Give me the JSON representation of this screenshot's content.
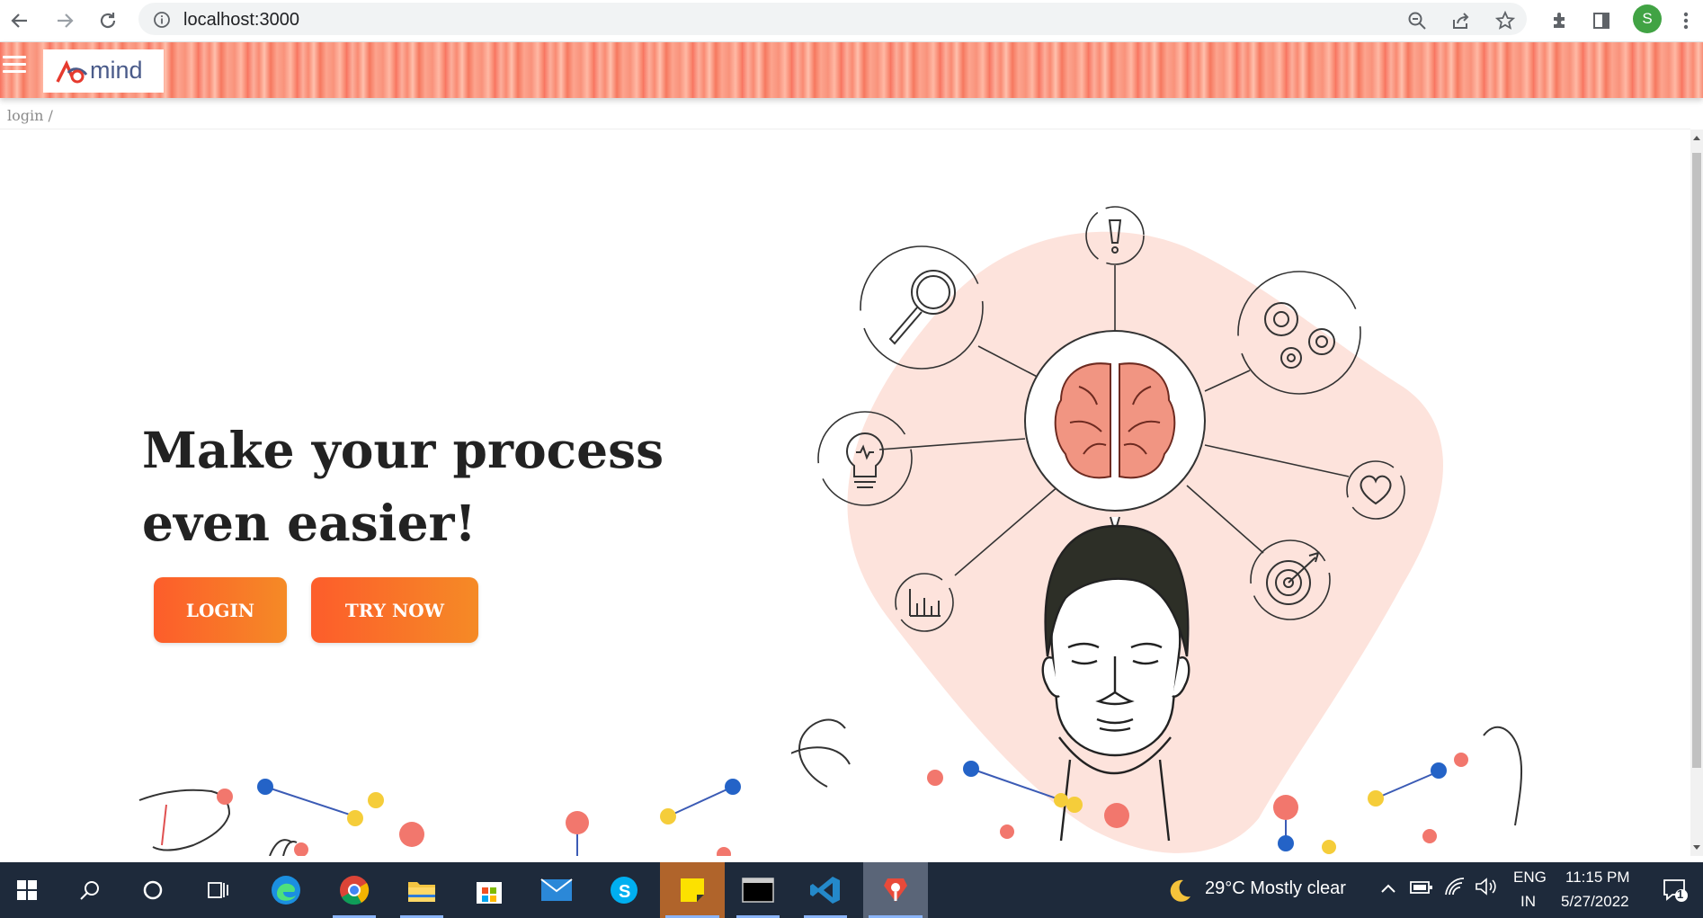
{
  "browser": {
    "url": "localhost:3000",
    "profile_initial": "S"
  },
  "app": {
    "logo_text": "mind",
    "breadcrumb": "login /"
  },
  "hero": {
    "title": "Make your process even easier!",
    "login_label": "LOGIN",
    "try_label": "TRY NOW"
  },
  "taskbar": {
    "weather": "29°C  Mostly clear",
    "lang_top": "ENG",
    "lang_bottom": "IN",
    "time": "11:15 PM",
    "date": "5/27/2022",
    "notifications": "1"
  },
  "colors": {
    "accent_start": "#fd5d2b",
    "accent_end": "#f58a26",
    "header": "#f8725e",
    "blob": "#fde3dc"
  }
}
